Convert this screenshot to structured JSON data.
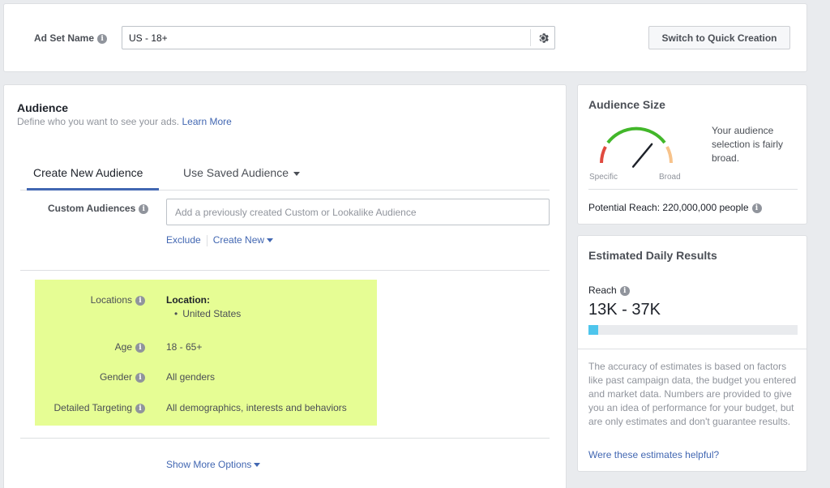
{
  "adset": {
    "label": "Ad Set Name",
    "value": "US - 18+",
    "quick_button": "Switch to Quick Creation"
  },
  "audience": {
    "title": "Audience",
    "subtitle": "Define who you want to see your ads.",
    "learn_more": "Learn More",
    "tabs": [
      {
        "label": "Create New Audience",
        "active": true
      },
      {
        "label": "Use Saved Audience",
        "active": false
      }
    ],
    "custom_audiences": {
      "label": "Custom Audiences",
      "placeholder": "Add a previously created Custom or Lookalike Audience",
      "exclude": "Exclude",
      "create_new": "Create New"
    },
    "targeting": {
      "locations_label": "Locations",
      "location_title": "Location:",
      "location_item": "United States",
      "age_label": "Age",
      "age_value": "18 - 65+",
      "gender_label": "Gender",
      "gender_value": "All genders",
      "detailed_label": "Detailed Targeting",
      "detailed_value": "All demographics, interests and behaviors"
    },
    "show_more": "Show More Options",
    "highlight_color": "#e6fd94"
  },
  "audience_size": {
    "title": "Audience Size",
    "specific": "Specific",
    "broad": "Broad",
    "description": "Your audience selection is fairly broad.",
    "potential_reach": "Potential Reach: 220,000,000 people",
    "needle_level": 0.72
  },
  "results": {
    "title": "Estimated Daily Results",
    "reach_label": "Reach",
    "reach_value": "13K - 37K",
    "reach_bar_fraction": 0.045,
    "note": "The accuracy of estimates is based on factors like past campaign data, the budget you entered and market data. Numbers are provided to give you an idea of performance for your budget, but are only estimates and don't guarantee results.",
    "helpful_link": "Were these estimates helpful?"
  },
  "colors": {
    "link": "#4267b2",
    "bar": "#4ec5ec",
    "gauge_red": "#e04a3f",
    "gauge_green": "#42b72a",
    "gauge_orange": "#f7b928"
  }
}
